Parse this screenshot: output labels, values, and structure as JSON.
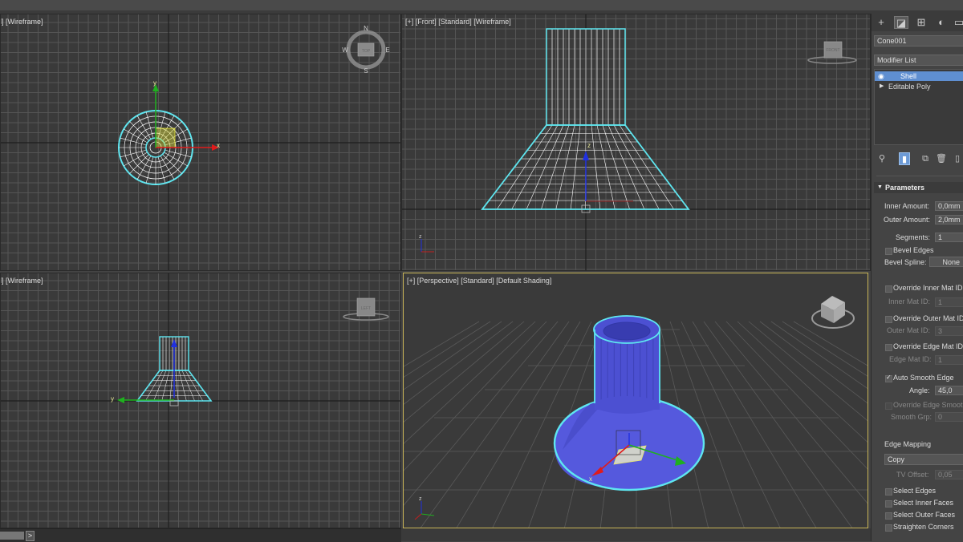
{
  "viewports": {
    "top": {
      "label": "d] [Wireframe]"
    },
    "front": {
      "label": "[+] [Front] [Standard] [Wireframe]",
      "cube_label": "FRONT"
    },
    "left": {
      "label": "d] [Wireframe]",
      "cube_label": "LEFT"
    },
    "perspective": {
      "label": "[+] [Perspective] [Standard] [Default Shading]"
    }
  },
  "compass": {
    "n": "N",
    "s": "S",
    "e": "E",
    "w": "W",
    "cube_label": "TOP"
  },
  "axes": {
    "x": "x",
    "y": "y",
    "z": "z"
  },
  "bottom_bar": {
    "next_arrow": ">"
  },
  "command_panel": {
    "object_name": "Cone001",
    "modifier_list": "Modifier List",
    "stack": [
      {
        "label": "Shell",
        "selected": true
      },
      {
        "label": "Editable Poly",
        "selected": false
      }
    ],
    "rollout_title": "Parameters",
    "params": {
      "inner_amount_label": "Inner Amount:",
      "inner_amount_value": "0,0mm",
      "outer_amount_label": "Outer Amount:",
      "outer_amount_value": "2,0mm",
      "segments_label": "Segments:",
      "segments_value": "1",
      "bevel_edges_label": "Bevel Edges",
      "bevel_spline_label": "Bevel Spline:",
      "bevel_spline_value": "None",
      "override_inner_label": "Override Inner Mat ID",
      "inner_mat_id_label": "Inner Mat ID:",
      "inner_mat_id_value": "1",
      "override_outer_label": "Override Outer Mat ID",
      "outer_mat_id_label": "Outer Mat ID:",
      "outer_mat_id_value": "3",
      "override_edge_label": "Override Edge Mat ID",
      "edge_mat_id_label": "Edge Mat ID:",
      "edge_mat_id_value": "1",
      "auto_smooth_label": "Auto Smooth Edge",
      "angle_label": "Angle:",
      "angle_value": "45,0",
      "override_edge_smooth_label": "Override Edge Smooth",
      "smooth_grp_label": "Smooth Grp:",
      "smooth_grp_value": "0",
      "edge_mapping_label": "Edge Mapping",
      "edge_mapping_value": "Copy",
      "tv_offset_label": "TV Offset:",
      "tv_offset_value": "0,05",
      "select_edges_label": "Select Edges",
      "select_inner_faces_label": "Select Inner Faces",
      "select_outer_faces_label": "Select Outer Faces",
      "straighten_corners_label": "Straighten Corners"
    }
  },
  "colors": {
    "viewport_bg": "#3a3a3a",
    "grid": "#555555",
    "selection_outline": "#5ee6f0",
    "object_fill": "#5a5ee0",
    "stack_selected": "#5f8fd1",
    "active_border": "#c8b457"
  }
}
